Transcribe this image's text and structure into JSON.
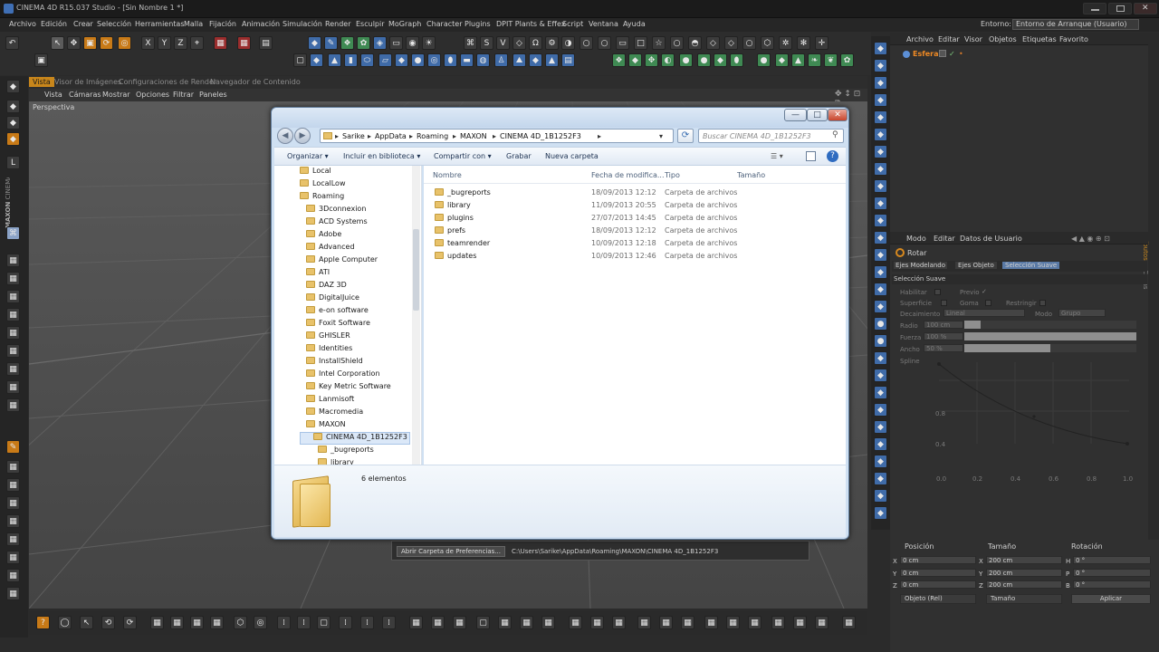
{
  "titlebar": {
    "title": "CINEMA 4D R15.037 Studio - [Sin Nombre 1 *]"
  },
  "menubar": {
    "items": [
      "Archivo",
      "Edición",
      "Crear",
      "Selección",
      "Herramientas",
      "Malla",
      "Fijación",
      "Animación",
      "Simulación",
      "Render",
      "Esculpir",
      "MoGraph",
      "Character",
      "Plugins",
      "DPIT Plants & Effex",
      "Script",
      "Ventana",
      "Ayuda"
    ],
    "environment_label": "Entorno:",
    "environment_value": "Entorno de Arranque (Usuario)"
  },
  "viewport": {
    "tabs": [
      "Vista",
      "Visor de Imágenes",
      "Configuraciones de Render",
      "Navegador de Contenido"
    ],
    "menu": [
      "Vista",
      "Cámaras",
      "Mostrar",
      "Opciones",
      "Filtrar",
      "Paneles"
    ],
    "label": "Perspectiva"
  },
  "brand": {
    "maxon": "MAXON",
    "cinema": "CINEMA 4D"
  },
  "objects_panel": {
    "menu": [
      "Archivo",
      "Editar",
      "Visor",
      "Objetos",
      "Etiquetas",
      "Favorito"
    ],
    "object_name": "Esfera"
  },
  "attr_panel": {
    "menu": [
      "Modo",
      "Editar",
      "Datos de Usuario"
    ],
    "tool": "Rotar",
    "tabs": [
      "Ejes Modelando",
      "Ejes Objeto",
      "Selección Suave"
    ],
    "section": "Selección Suave",
    "habilitar": "Habilitar",
    "previo": "Previo",
    "superficie": "Superficie",
    "goma": "Goma",
    "restringir": "Restringir",
    "decaimiento": "Decaimiento",
    "decaimiento_val": "Lineal",
    "modo": "Modo",
    "modo_val": "Grupo",
    "radio": "Radio",
    "radio_val": "100 cm",
    "fuerza": "Fuerza",
    "fuerza_val": "100 %",
    "ancho": "Ancho",
    "ancho_val": "50 %",
    "spline": "Spline",
    "yticks": [
      "0.8",
      "0.4"
    ],
    "xticks": [
      "0.0",
      "0.2",
      "0.4",
      "0.6",
      "0.8",
      "1.0"
    ],
    "side_tabs": [
      "Atributos",
      "Capas"
    ]
  },
  "coords": {
    "headers": [
      "Posición",
      "Tamaño",
      "Rotación"
    ],
    "rows": [
      {
        "axis": "X",
        "pos": "0 cm",
        "size_axis": "X",
        "size": "200 cm",
        "rot_axis": "H",
        "rot": "0 °"
      },
      {
        "axis": "Y",
        "pos": "0 cm",
        "size_axis": "Y",
        "size": "200 cm",
        "rot_axis": "P",
        "rot": "0 °"
      },
      {
        "axis": "Z",
        "pos": "0 cm",
        "size_axis": "Z",
        "size": "200 cm",
        "rot_axis": "B",
        "rot": "0 °"
      }
    ],
    "mode_select": "Objeto (Rel)",
    "size_select": "Tamaño",
    "apply": "Aplicar"
  },
  "statusbar": {
    "button": "Abrir Carpeta de Preferencias...",
    "path": "C:\\Users\\Sarike\\AppData\\Roaming\\MAXON\\CINEMA 4D_1B1252F3"
  },
  "explorer": {
    "breadcrumb": [
      "Sarike",
      "AppData",
      "Roaming",
      "MAXON",
      "CINEMA 4D_1B1252F3"
    ],
    "search_placeholder": "Buscar CINEMA 4D_1B1252F3",
    "commands": [
      "Organizar",
      "Incluir en biblioteca",
      "Compartir con",
      "Grabar",
      "Nueva carpeta"
    ],
    "tree": [
      "Local",
      "LocalLow",
      "Roaming",
      "3Dconnexion",
      "ACD Systems",
      "Adobe",
      "Advanced",
      "Apple Computer",
      "ATI",
      "DAZ 3D",
      "DigitalJuice",
      "e-on software",
      "Foxit Software",
      "GHISLER",
      "Identities",
      "InstallShield",
      "Intel Corporation",
      "Key Metric Software",
      "Lanmisoft",
      "Macromedia",
      "MAXON",
      "CINEMA 4D_1B1252F3",
      "_bugreports",
      "library"
    ],
    "columns": [
      "Nombre",
      "Fecha de modifica...",
      "Tipo",
      "Tamaño"
    ],
    "files": [
      {
        "name": "_bugreports",
        "date": "18/09/2013 12:12",
        "type": "Carpeta de archivos"
      },
      {
        "name": "library",
        "date": "11/09/2013 20:55",
        "type": "Carpeta de archivos"
      },
      {
        "name": "plugins",
        "date": "27/07/2013 14:45",
        "type": "Carpeta de archivos"
      },
      {
        "name": "prefs",
        "date": "18/09/2013 12:12",
        "type": "Carpeta de archivos"
      },
      {
        "name": "teamrender",
        "date": "10/09/2013 12:18",
        "type": "Carpeta de archivos"
      },
      {
        "name": "updates",
        "date": "10/09/2013 12:46",
        "type": "Carpeta de archivos"
      }
    ],
    "item_count": "6 elementos"
  }
}
